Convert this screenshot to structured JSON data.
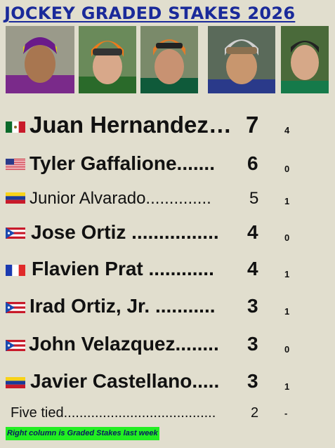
{
  "title": "JOCKEY GRADED STAKES 2026",
  "photos": [
    {
      "name": "jockey-photo-1",
      "silk": "#7a2a8a",
      "helmet": "#d8cf1a"
    },
    {
      "name": "jockey-photo-2",
      "silk": "#2a6a2a",
      "helmet": "#f07a1a"
    },
    {
      "name": "jockey-photo-3",
      "silk": "#0f5a3a",
      "helmet": "#e07b2a"
    },
    {
      "name": "jockey-photo-4",
      "silk": "#2a3a8a",
      "helmet": "#d0d0d0"
    },
    {
      "name": "jockey-photo-5",
      "silk": "#157a4a",
      "helmet": "#222222"
    }
  ],
  "rows": [
    {
      "flag": "mexico-flag-icon",
      "name": "Juan Hernandez…",
      "wins": "7",
      "last_week": "4"
    },
    {
      "flag": "usa-flag-icon",
      "name": "Tyler Gaffalione....... ",
      "wins": "6",
      "last_week": "0"
    },
    {
      "flag": "venezuela-flag-icon",
      "name": "Junior Alvarado..............",
      "wins": "5",
      "last_week": "1"
    },
    {
      "flag": "puerto-rico-flag-icon",
      "name": "Jose Ortiz ................ ",
      "wins": "4",
      "last_week": "0"
    },
    {
      "flag": "france-flag-icon",
      "name": "Flavien Prat ............ ",
      "wins": "4",
      "last_week": "1"
    },
    {
      "flag": "puerto-rico-flag-icon",
      "name": "Irad Ortiz, Jr. ........... ",
      "wins": "3",
      "last_week": "1"
    },
    {
      "flag": "puerto-rico-flag-icon",
      "name": "John Velazquez........ ",
      "wins": "3",
      "last_week": "0"
    },
    {
      "flag": "venezuela-flag-icon",
      "name": "Javier Castellano..... ",
      "wins": "3",
      "last_week": "1"
    }
  ],
  "tied": {
    "name": "Five tied.......................................",
    "wins": "2",
    "last_week": "-"
  },
  "note": "Right column is Graded Stakes last week"
}
